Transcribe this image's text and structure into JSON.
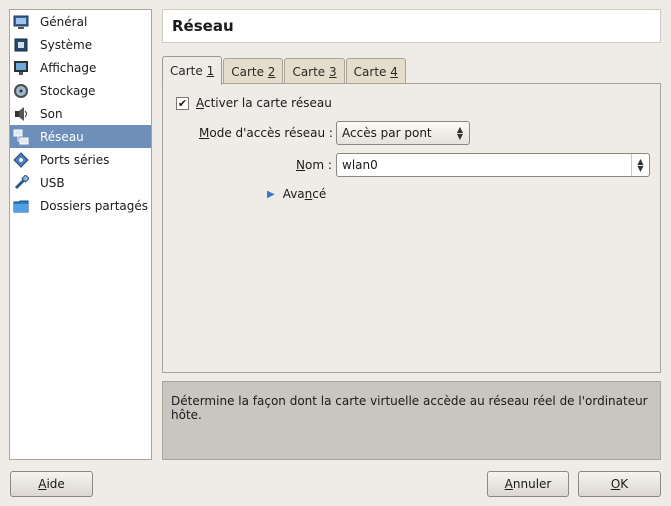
{
  "sidebar": {
    "items": [
      {
        "label": "Général",
        "icon": "monitor-icon"
      },
      {
        "label": "Système",
        "icon": "chip-icon"
      },
      {
        "label": "Affichage",
        "icon": "display-icon"
      },
      {
        "label": "Stockage",
        "icon": "disk-icon"
      },
      {
        "label": "Son",
        "icon": "speaker-icon"
      },
      {
        "label": "Réseau",
        "icon": "network-icon",
        "selected": true
      },
      {
        "label": "Ports séries",
        "icon": "serial-port-icon"
      },
      {
        "label": "USB",
        "icon": "usb-icon"
      },
      {
        "label": "Dossiers partagés",
        "icon": "folder-icon"
      }
    ]
  },
  "header": {
    "title": "Réseau"
  },
  "tabs": [
    {
      "prefix": "Carte ",
      "mnemonic": "1"
    },
    {
      "prefix": "Carte ",
      "mnemonic": "2"
    },
    {
      "prefix": "Carte ",
      "mnemonic": "3"
    },
    {
      "prefix": "Carte ",
      "mnemonic": "4"
    }
  ],
  "adapter": {
    "enable_mnemonic": "A",
    "enable_rest": "ctiver la carte réseau",
    "enabled": true,
    "mode_mnemonic": "M",
    "mode_rest": "ode d'accès réseau :",
    "mode_value": "Accès par pont",
    "name_mnemonic": "N",
    "name_rest": "om :",
    "name_value": "wlan0",
    "advanced_pre": "Ava",
    "advanced_mnemonic": "n",
    "advanced_post": "cé"
  },
  "description": "Détermine la façon dont la carte virtuelle accède au réseau réel de l'ordinateur hôte.",
  "buttons": {
    "help_mnemonic": "A",
    "help_rest": "ide",
    "cancel_mnemonic": "A",
    "cancel_rest": "nnuler",
    "ok_mnemonic": "O",
    "ok_rest": "K"
  },
  "colors": {
    "selection": "#6d8fb9",
    "window_bg": "#efebe7"
  }
}
